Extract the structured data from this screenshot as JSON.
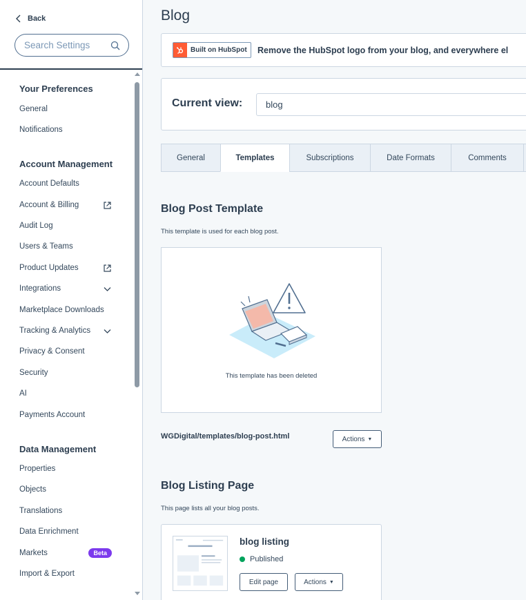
{
  "sidebar": {
    "back_label": "Back",
    "search_placeholder": "Search Settings",
    "sections": [
      {
        "title": "Your Preferences",
        "items": [
          {
            "label": "General"
          },
          {
            "label": "Notifications"
          }
        ]
      },
      {
        "title": "Account Management",
        "items": [
          {
            "label": "Account Defaults"
          },
          {
            "label": "Account & Billing",
            "icon": "external-link-icon"
          },
          {
            "label": "Audit Log"
          },
          {
            "label": "Users & Teams"
          },
          {
            "label": "Product Updates",
            "icon": "external-link-icon"
          },
          {
            "label": "Integrations",
            "icon": "chevron-down-icon"
          },
          {
            "label": "Marketplace Downloads"
          },
          {
            "label": "Tracking & Analytics",
            "icon": "chevron-down-icon"
          },
          {
            "label": "Privacy & Consent"
          },
          {
            "label": "Security"
          },
          {
            "label": "AI"
          },
          {
            "label": "Payments Account"
          }
        ]
      },
      {
        "title": "Data Management",
        "items": [
          {
            "label": "Properties"
          },
          {
            "label": "Objects"
          },
          {
            "label": "Translations"
          },
          {
            "label": "Data Enrichment"
          },
          {
            "label": "Markets",
            "badge": "Beta"
          },
          {
            "label": "Import & Export"
          }
        ]
      }
    ]
  },
  "main": {
    "title": "Blog",
    "banner": {
      "badge_label": "Built on HubSpot",
      "text": "Remove the HubSpot logo from your blog, and everywhere el"
    },
    "current_view": {
      "label": "Current view:",
      "value": "blog"
    },
    "tabs": [
      {
        "label": "General"
      },
      {
        "label": "Templates",
        "active": true
      },
      {
        "label": "Subscriptions"
      },
      {
        "label": "Date Formats"
      },
      {
        "label": "Comments"
      }
    ],
    "post_template": {
      "title": "Blog Post Template",
      "description": "This template is used for each blog post.",
      "deleted_message": "This template has been deleted",
      "path": "WGDigital/templates/blog-post.html",
      "actions_label": "Actions"
    },
    "listing_page": {
      "title": "Blog Listing Page",
      "description": "This page lists all your blog posts.",
      "card_title": "blog listing",
      "status": "Published",
      "edit_label": "Edit page",
      "actions_label": "Actions"
    }
  },
  "colors": {
    "hubspot_orange": "#ff5c35",
    "published_green": "#00a35c",
    "beta_purple": "#7c3aed",
    "text_dark": "#2d3e50"
  }
}
